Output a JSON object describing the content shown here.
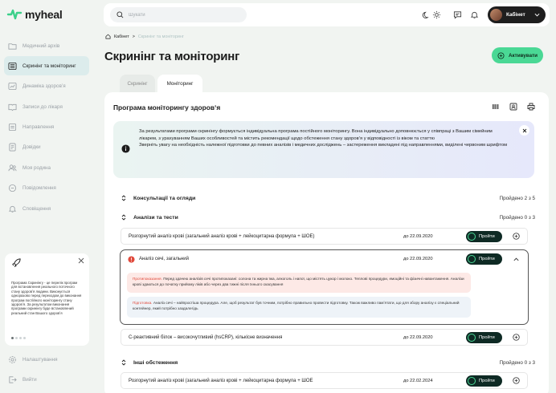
{
  "app": {
    "logo_text": "myheal"
  },
  "sidebar": {
    "items": [
      {
        "label": "Медичний архів",
        "icon": "folder-icon",
        "active": false
      },
      {
        "label": "Скринінг та моніторинг",
        "icon": "list-icon",
        "active": true
      },
      {
        "label": "Динаміка здоровʼя",
        "icon": "chart-icon",
        "active": false
      },
      {
        "label": "Записи до лікаря",
        "icon": "book-icon",
        "active": false
      },
      {
        "label": "Направлення",
        "icon": "document-icon",
        "active": false
      },
      {
        "label": "Довідки",
        "icon": "certificate-icon",
        "active": false
      },
      {
        "label": "Моя родина",
        "icon": "family-icon",
        "active": false
      },
      {
        "label": "Повідомлення",
        "icon": "message-icon",
        "active": false
      },
      {
        "label": "Сповіщення",
        "icon": "bell-icon",
        "active": false
      }
    ],
    "promo": {
      "text": "Програма Скринінгу - це перелік програм для встановлення реального поточного стану здоровʼя людини. Виконується одноразово перед переходом до виконання програм постійного моніторингу стану здоровʼя. За результатом виконання програми скринінгу буде встановлений реальний стан Вашого здоровʼя"
    },
    "bottom_items": [
      {
        "label": "Налаштування",
        "icon": "gear-icon"
      },
      {
        "label": "Вийти",
        "icon": "logout-icon"
      }
    ]
  },
  "header": {
    "search_placeholder": "Шукати",
    "cabinet_label": "Кабінет"
  },
  "breadcrumb": {
    "home": "Кабінет",
    "separator": ">",
    "current": "Скринінг та моніторинг"
  },
  "page": {
    "title": "Скринінг та моніторинг",
    "activate_label": "Активувати",
    "tabs": [
      {
        "label": "Скринінг",
        "active": false
      },
      {
        "label": "Моніторинг",
        "active": true
      }
    ]
  },
  "program": {
    "title": "Програма моніторингу здоровʼя",
    "info_line1": "За результатами програми скринінгу формується індивідуальна програма постійного моніторингу. Вона індивідуально доповнюється у співпраці з Вашим сімейним лікарем, з урахуванням Ваших особливостей та містить рекомендації щодо обстеження стану здоровʼя у відповідності із віком та статтю",
    "info_line2": "Зверніть увагу на необхідність належної підготовки до певних аналізів і медичних досліджень – застереження викладені під направленнями, виділені червоним шрифтом",
    "pass_label": "Пройти",
    "sections": [
      {
        "title": "Консультації та огляди",
        "count": "Пройдено 2 з 5"
      },
      {
        "title": "Аналізи та тести",
        "count": "Пройдено 0 з 3"
      },
      {
        "title": "Інші обстеження",
        "count": "Пройдено 0 з 3"
      }
    ],
    "tests": [
      {
        "name": "Розгорнутий аналіз крові (загальний аналіз крові + лейкоцитарна формула + ШОЕ)",
        "date": "до 22.09.2020"
      },
      {
        "name": "Аналіз сечі, загальний",
        "date": "до 22.09.2020"
      },
      {
        "name": "С-реактивний білок – високочутливий (hsCRP), кількісне визначення",
        "date": "до 22.09.2020"
      }
    ],
    "urine_details": {
      "contra_label": "Протипоказання.",
      "contra_text": "Перед здачею аналізів сечі протипоказані: солона та жирна їжа, алкоголь і напої, що містять цукор і молоко. Теплові процедури, емоційні та фізичні навантаження. Аналізи крові здаються до початку прийому ліків або через два тижні після їхнього скасування",
      "prep_label": "Підготовка.",
      "prep_text": "Аналіз сечі – найпростіша процедура. Але, щоб результат був точним, потрібно правильно провести підготовку. Також важливо памʼятати, що для збору аналізу є спеціальний контейнер, який потрібно заздалегідь"
    },
    "other": [
      {
        "name": "Розгорнутий аналіз крові (загальний аналіз крові + лейкоцитарна формула + ШОЕ",
        "date": "до 22.02.2024"
      }
    ]
  },
  "colors": {
    "accent_green": "#4ad895",
    "dark": "#0e2a24",
    "warning_red": "#e0493b",
    "active_nav": "#dcecec"
  }
}
